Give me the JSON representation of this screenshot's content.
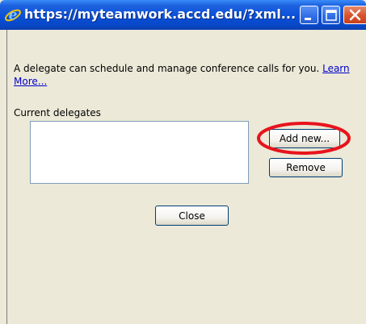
{
  "window": {
    "title": "https://myteamwork.accd.edu/?xml...",
    "controls": {
      "minimize": "minimize",
      "maximize": "maximize",
      "close": "close"
    }
  },
  "dialog": {
    "description": "A delegate can schedule and manage conference calls for you.",
    "learn_more": "Learn More...",
    "current_delegates_label": "Current delegates",
    "delegates": [],
    "buttons": {
      "add_new": "Add new...",
      "remove": "Remove",
      "close": "Close"
    }
  },
  "annotation": {
    "color": "#e8141c"
  },
  "colors": {
    "titlebar": "#0a4fd6",
    "dialog_bg": "#ece9d8",
    "link": "#0000cc"
  },
  "icons": [
    "internet-explorer-icon",
    "minimize-icon",
    "maximize-icon",
    "close-icon"
  ]
}
